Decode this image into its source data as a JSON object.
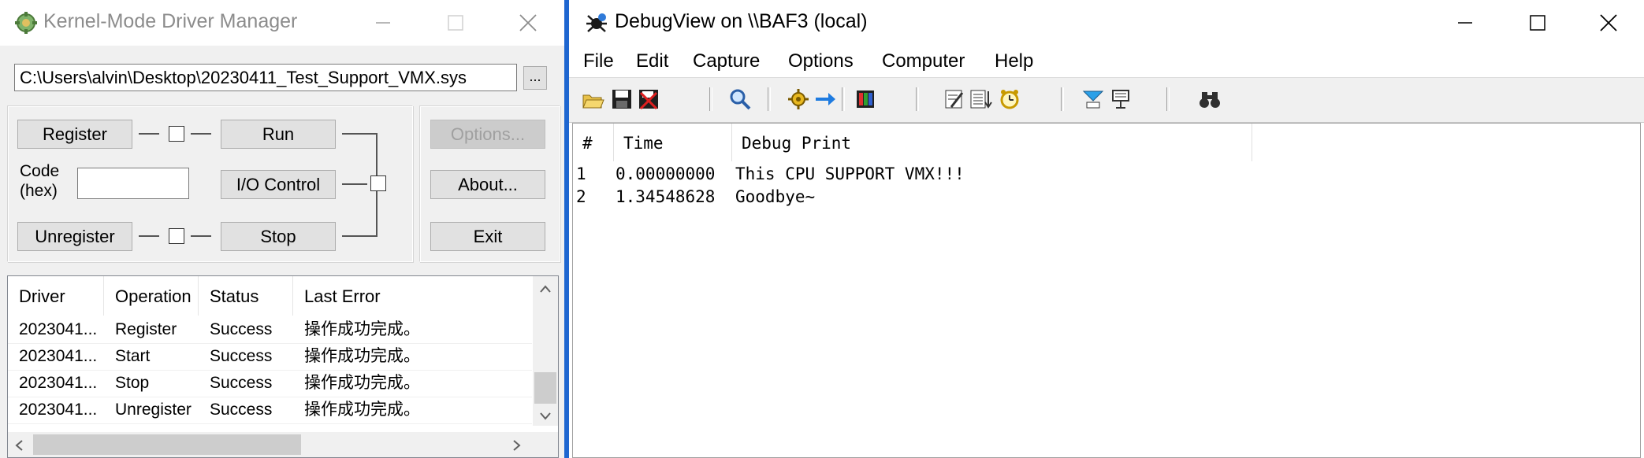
{
  "driver_manager": {
    "title": "Kernel-Mode Driver Manager",
    "driver_path": "C:\\Users\\alvin\\Desktop\\20230411_Test_Support_VMX.sys",
    "browse_label": "...",
    "buttons": {
      "register": "Register",
      "run": "Run",
      "io_control": "I/O Control",
      "unregister": "Unregister",
      "stop": "Stop",
      "options": "Options...",
      "about": "About...",
      "exit": "Exit"
    },
    "code_label_line1": "Code",
    "code_label_line2": "(hex)",
    "code_value": "",
    "log_columns": [
      "Driver",
      "Operation",
      "Status",
      "Last Error"
    ],
    "log_rows": [
      {
        "driver": "2023041...",
        "operation": "Register",
        "status": "Success",
        "last_error": "操作成功完成。"
      },
      {
        "driver": "2023041...",
        "operation": "Start",
        "status": "Success",
        "last_error": "操作成功完成。"
      },
      {
        "driver": "2023041...",
        "operation": "Stop",
        "status": "Success",
        "last_error": "操作成功完成。"
      },
      {
        "driver": "2023041...",
        "operation": "Unregister",
        "status": "Success",
        "last_error": "操作成功完成。"
      }
    ]
  },
  "debugview": {
    "title": "DebugView on \\\\BAF3 (local)",
    "menu": [
      "File",
      "Edit",
      "Capture",
      "Options",
      "Computer",
      "Help"
    ],
    "toolbar_icons": [
      "open-icon",
      "save-icon",
      "clear-icon",
      "find-icon",
      "capture-icon",
      "autoscroll-icon",
      "history-icon",
      "highlight-icon",
      "filter-icon",
      "clock-icon",
      "kernel-capture-icon",
      "connect-icon",
      "search-binoculars-icon"
    ],
    "columns": [
      "#",
      "Time",
      "Debug Print"
    ],
    "rows": [
      {
        "num": "1",
        "time": "0.00000000",
        "message": "This CPU SUPPORT VMX!!!"
      },
      {
        "num": "2",
        "time": "1.34548628",
        "message": "Goodbye~"
      }
    ]
  },
  "colors": {
    "desktop_blue": "#1e66d0",
    "window_bg": "#f0f0f0",
    "button_face": "#e1e1e1"
  }
}
